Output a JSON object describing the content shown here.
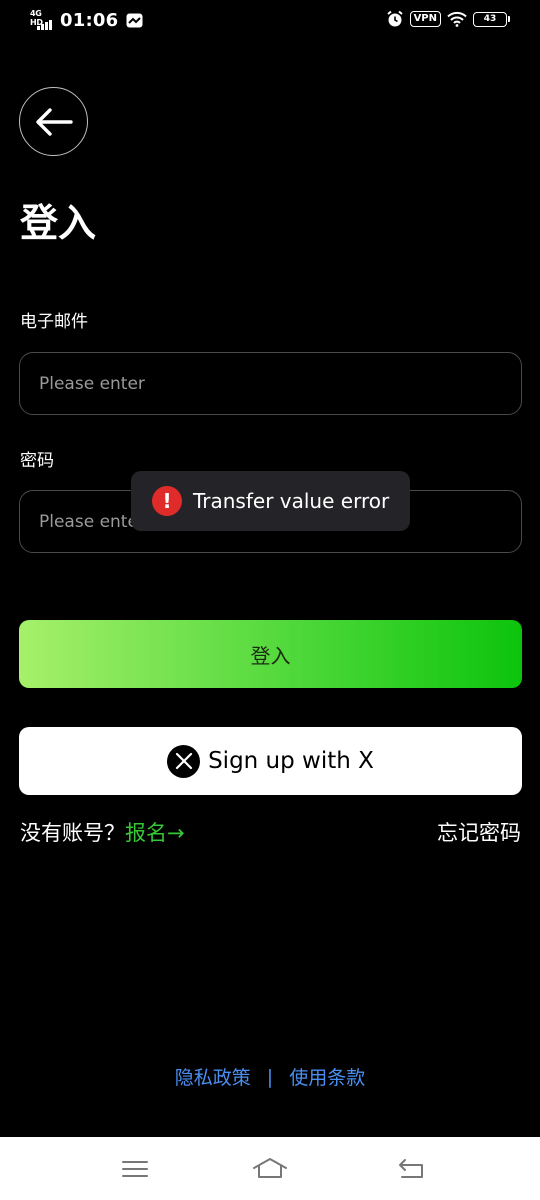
{
  "status_bar": {
    "network": "4G HD",
    "time": "01:06",
    "vpn": "VPN",
    "battery": "43"
  },
  "icons": {
    "back": "arrow-left-icon",
    "error": "exclamation-circle-icon",
    "x_logo": "x-logo-icon",
    "alarm": "alarm-icon",
    "wifi": "wifi-icon",
    "menu": "menu-icon",
    "home": "home-icon",
    "back_nav": "back-nav-icon"
  },
  "page": {
    "title": "登入"
  },
  "form": {
    "email_label": "电子邮件",
    "email_placeholder": "Please enter",
    "password_label": "密码",
    "password_placeholder": "Please enter",
    "submit_label": "登入",
    "x_signup_label": "Sign up with X"
  },
  "toast": {
    "message": "Transfer value error",
    "icon_text": "!"
  },
  "links": {
    "no_account": "没有账号？",
    "signup": "报名→",
    "forgot_password": "忘记密码",
    "privacy": "隐私政策",
    "separator": "|",
    "terms": "使用条款"
  },
  "colors": {
    "background": "#000000",
    "accent_green": "#36c736",
    "link_blue": "#4a8ef0",
    "error_red": "#e02b2b",
    "button_gradient_start": "#a6f06a",
    "button_gradient_end": "#0cc40c"
  }
}
